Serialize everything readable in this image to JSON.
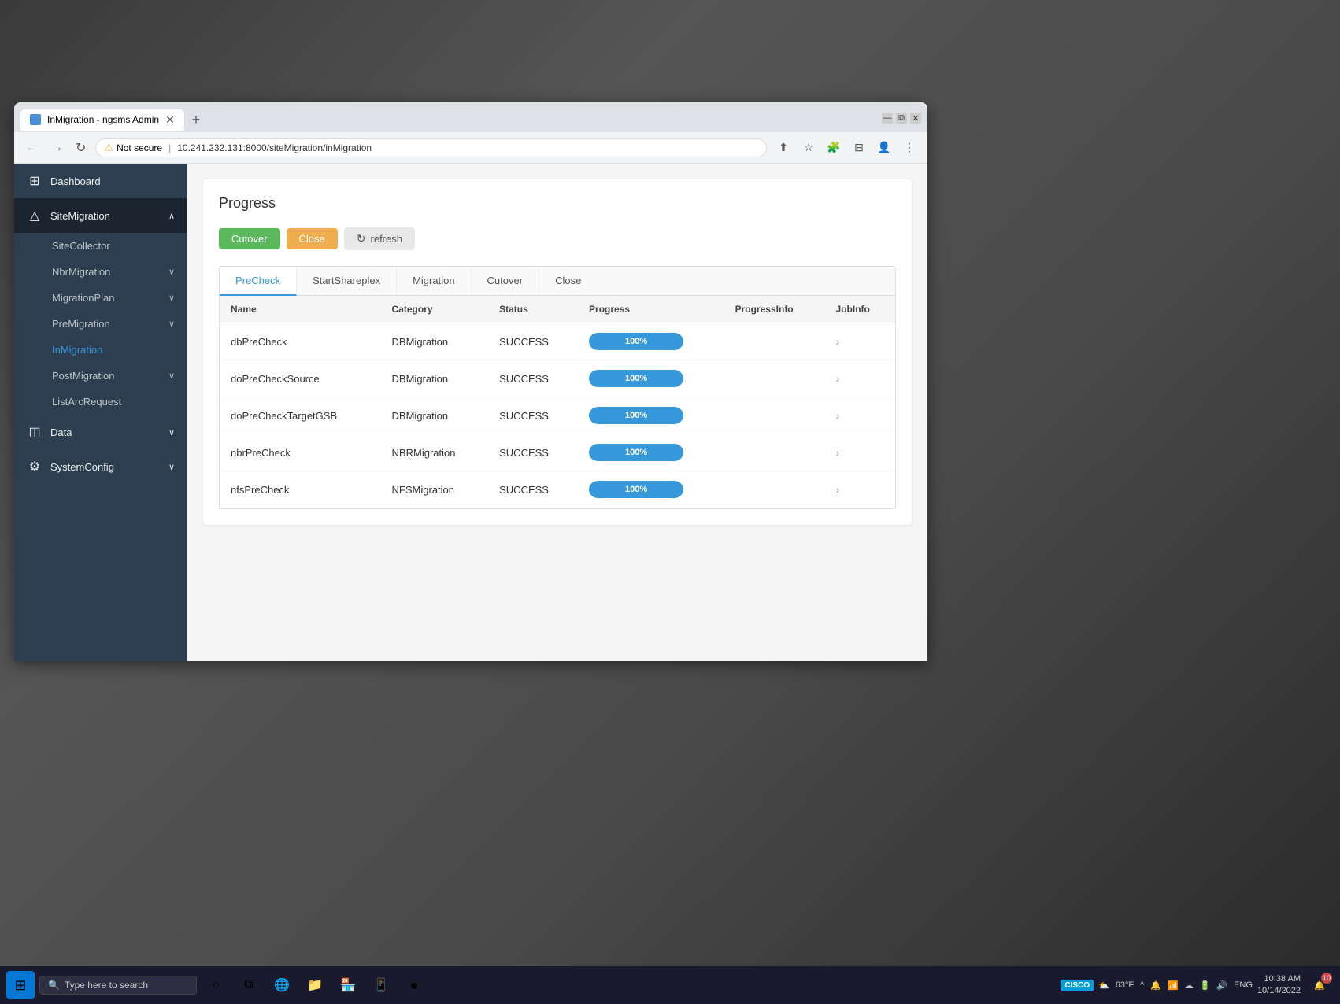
{
  "browser": {
    "tab_title": "InMigration - ngsms Admin",
    "url": "10.241.232.131:8000/siteMigration/inMigration",
    "security_label": "Not secure"
  },
  "sidebar": {
    "items": [
      {
        "id": "dashboard",
        "label": "Dashboard",
        "icon": "⊞",
        "type": "top"
      },
      {
        "id": "site-migration",
        "label": "SiteMigration",
        "icon": "△",
        "type": "section",
        "expanded": true
      },
      {
        "id": "site-collector",
        "label": "SiteCollector",
        "type": "sub"
      },
      {
        "id": "nbr-migration",
        "label": "NbrMigration",
        "type": "sub-section"
      },
      {
        "id": "migration-plan",
        "label": "MigrationPlan",
        "type": "sub-section"
      },
      {
        "id": "pre-migration",
        "label": "PreMigration",
        "type": "sub-section"
      },
      {
        "id": "in-migration",
        "label": "InMigration",
        "type": "sub",
        "active": true
      },
      {
        "id": "post-migration",
        "label": "PostMigration",
        "type": "sub-section"
      },
      {
        "id": "list-arc-request",
        "label": "ListArcRequest",
        "type": "sub"
      },
      {
        "id": "data",
        "label": "Data",
        "icon": "◫",
        "type": "section"
      },
      {
        "id": "system-config",
        "label": "SystemConfig",
        "icon": "⚙",
        "type": "section"
      }
    ]
  },
  "main": {
    "section_title": "Progress",
    "buttons": {
      "cutover": "Cutover",
      "close": "Close",
      "refresh": "refresh"
    },
    "tabs": [
      {
        "id": "precheck",
        "label": "PreCheck",
        "active": true
      },
      {
        "id": "start-shareplex",
        "label": "StartShareplex"
      },
      {
        "id": "migration",
        "label": "Migration"
      },
      {
        "id": "cutover",
        "label": "Cutover"
      },
      {
        "id": "close",
        "label": "Close"
      }
    ],
    "table": {
      "columns": [
        "Name",
        "Category",
        "Status",
        "Progress",
        "ProgressInfo",
        "JobInfo"
      ],
      "rows": [
        {
          "name": "dbPreCheck",
          "category": "DBMigration",
          "status": "SUCCESS",
          "progress": 100
        },
        {
          "name": "doPreCheckSource",
          "category": "DBMigration",
          "status": "SUCCESS",
          "progress": 100
        },
        {
          "name": "doPreCheckTargetGSB",
          "category": "DBMigration",
          "status": "SUCCESS",
          "progress": 100
        },
        {
          "name": "nbrPreCheck",
          "category": "NBRMigration",
          "status": "SUCCESS",
          "progress": 100
        },
        {
          "name": "nfsPreCheck",
          "category": "NFSMigration",
          "status": "SUCCESS",
          "progress": 100
        }
      ]
    }
  },
  "taskbar": {
    "search_placeholder": "Type here to search",
    "clock_time": "10:38 AM",
    "clock_date": "10/14/2022",
    "temperature": "63°F",
    "language": "ENG",
    "notification_num": "10"
  }
}
